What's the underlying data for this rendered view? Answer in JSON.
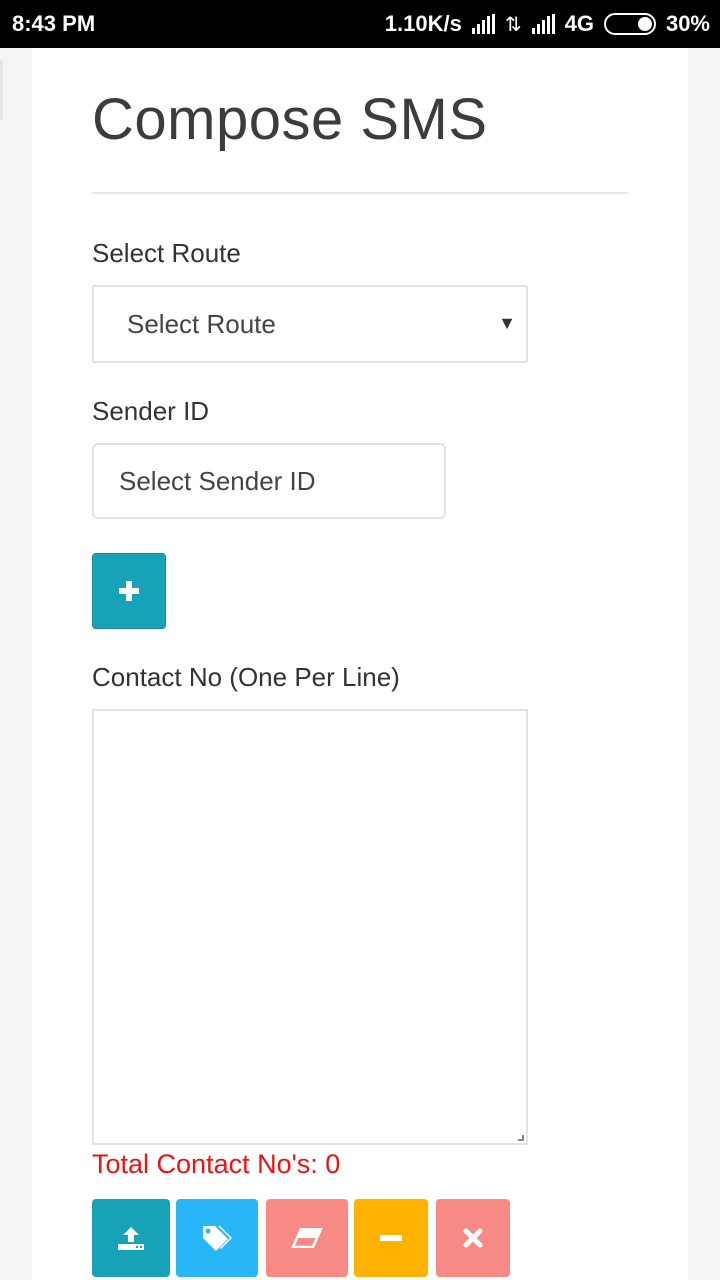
{
  "status_bar": {
    "time": "8:43 PM",
    "speed": "1.10K/s",
    "network": "4G",
    "battery": "30%"
  },
  "page": {
    "title": "Compose SMS"
  },
  "route": {
    "label": "Select Route",
    "selected": "Select Route"
  },
  "sender": {
    "label": "Sender ID",
    "placeholder": "Select Sender ID"
  },
  "add_button": {
    "icon": "plus-icon"
  },
  "contacts": {
    "label": "Contact No (One Per Line)",
    "value": "",
    "total_label": "Total Contact No's: 0"
  },
  "actions": [
    {
      "name": "upload",
      "icon": "upload-icon",
      "color": "#17a2b8"
    },
    {
      "name": "tags",
      "icon": "tags-icon",
      "color": "#29b6f6"
    },
    {
      "name": "erase",
      "icon": "eraser-icon",
      "color": "#f78a85"
    },
    {
      "name": "remove",
      "icon": "minus-icon",
      "color": "#ffb300"
    },
    {
      "name": "clear",
      "icon": "close-icon",
      "color": "#f78a85"
    }
  ]
}
